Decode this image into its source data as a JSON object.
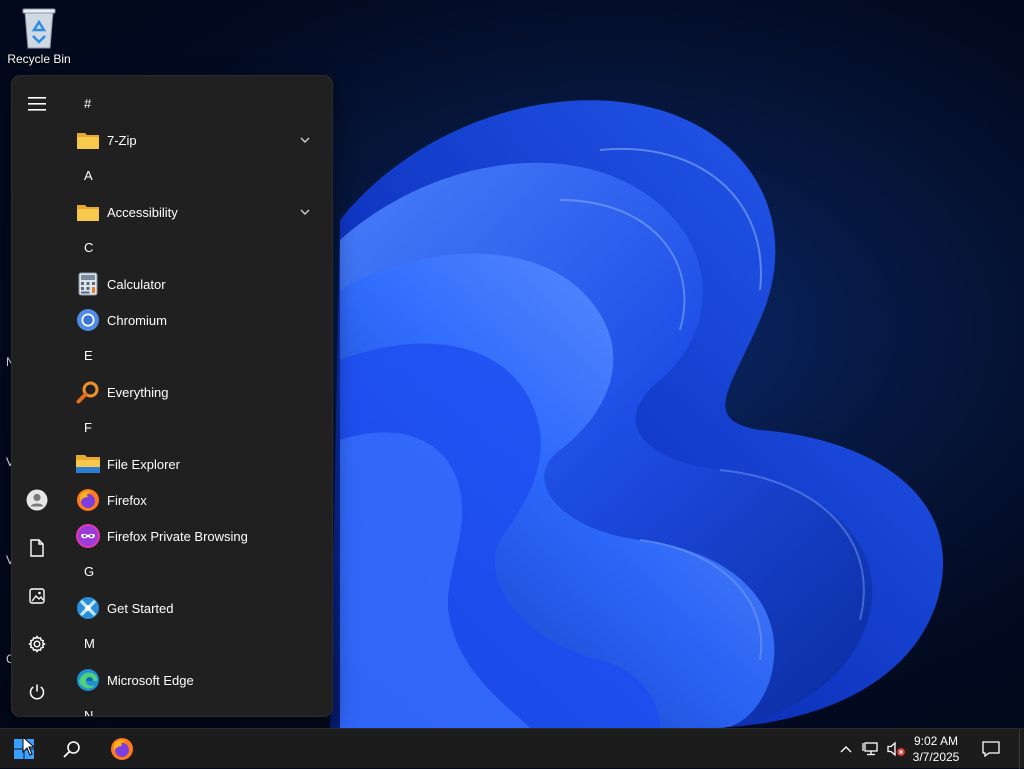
{
  "desktop": {
    "recycle_bin_label": "Recycle Bin",
    "edge_letters": [
      "N",
      "V",
      "V",
      "C"
    ]
  },
  "start_menu": {
    "groups": [
      {
        "letter": "#",
        "apps": [
          {
            "name": "7-Zip",
            "icon": "folder-icon",
            "expandable": true
          }
        ]
      },
      {
        "letter": "A",
        "apps": [
          {
            "name": "Accessibility",
            "icon": "folder-icon",
            "expandable": true
          }
        ]
      },
      {
        "letter": "C",
        "apps": [
          {
            "name": "Calculator",
            "icon": "calculator-icon"
          },
          {
            "name": "Chromium",
            "icon": "chromium-icon"
          }
        ]
      },
      {
        "letter": "E",
        "apps": [
          {
            "name": "Everything",
            "icon": "everything-search-icon"
          }
        ]
      },
      {
        "letter": "F",
        "apps": [
          {
            "name": "File Explorer",
            "icon": "file-explorer-icon"
          },
          {
            "name": "Firefox",
            "icon": "firefox-icon"
          },
          {
            "name": "Firefox Private Browsing",
            "icon": "firefox-private-icon"
          }
        ]
      },
      {
        "letter": "G",
        "apps": [
          {
            "name": "Get Started",
            "icon": "get-started-icon"
          }
        ]
      },
      {
        "letter": "M",
        "apps": [
          {
            "name": "Microsoft Edge",
            "icon": "edge-icon"
          }
        ]
      },
      {
        "letter": "N",
        "apps": []
      }
    ],
    "rail_icons": [
      "hamburger-menu-icon",
      "user-avatar-icon",
      "documents-icon",
      "pictures-icon",
      "settings-icon",
      "power-icon"
    ]
  },
  "taskbar": {
    "clock_time": "9:02 AM",
    "clock_date": "3/7/2025",
    "pinned": [
      "start-icon",
      "search-icon",
      "firefox-icon"
    ],
    "tray": [
      "chevron-up-icon",
      "network-icon",
      "volume-muted-icon",
      "notification-icon"
    ]
  },
  "colors": {
    "menu_bg": "#202020",
    "taskbar_bg": "#1c1c1c",
    "folder_yellow": "#f4c542",
    "wallpaper_blue": "#1f5cff"
  }
}
